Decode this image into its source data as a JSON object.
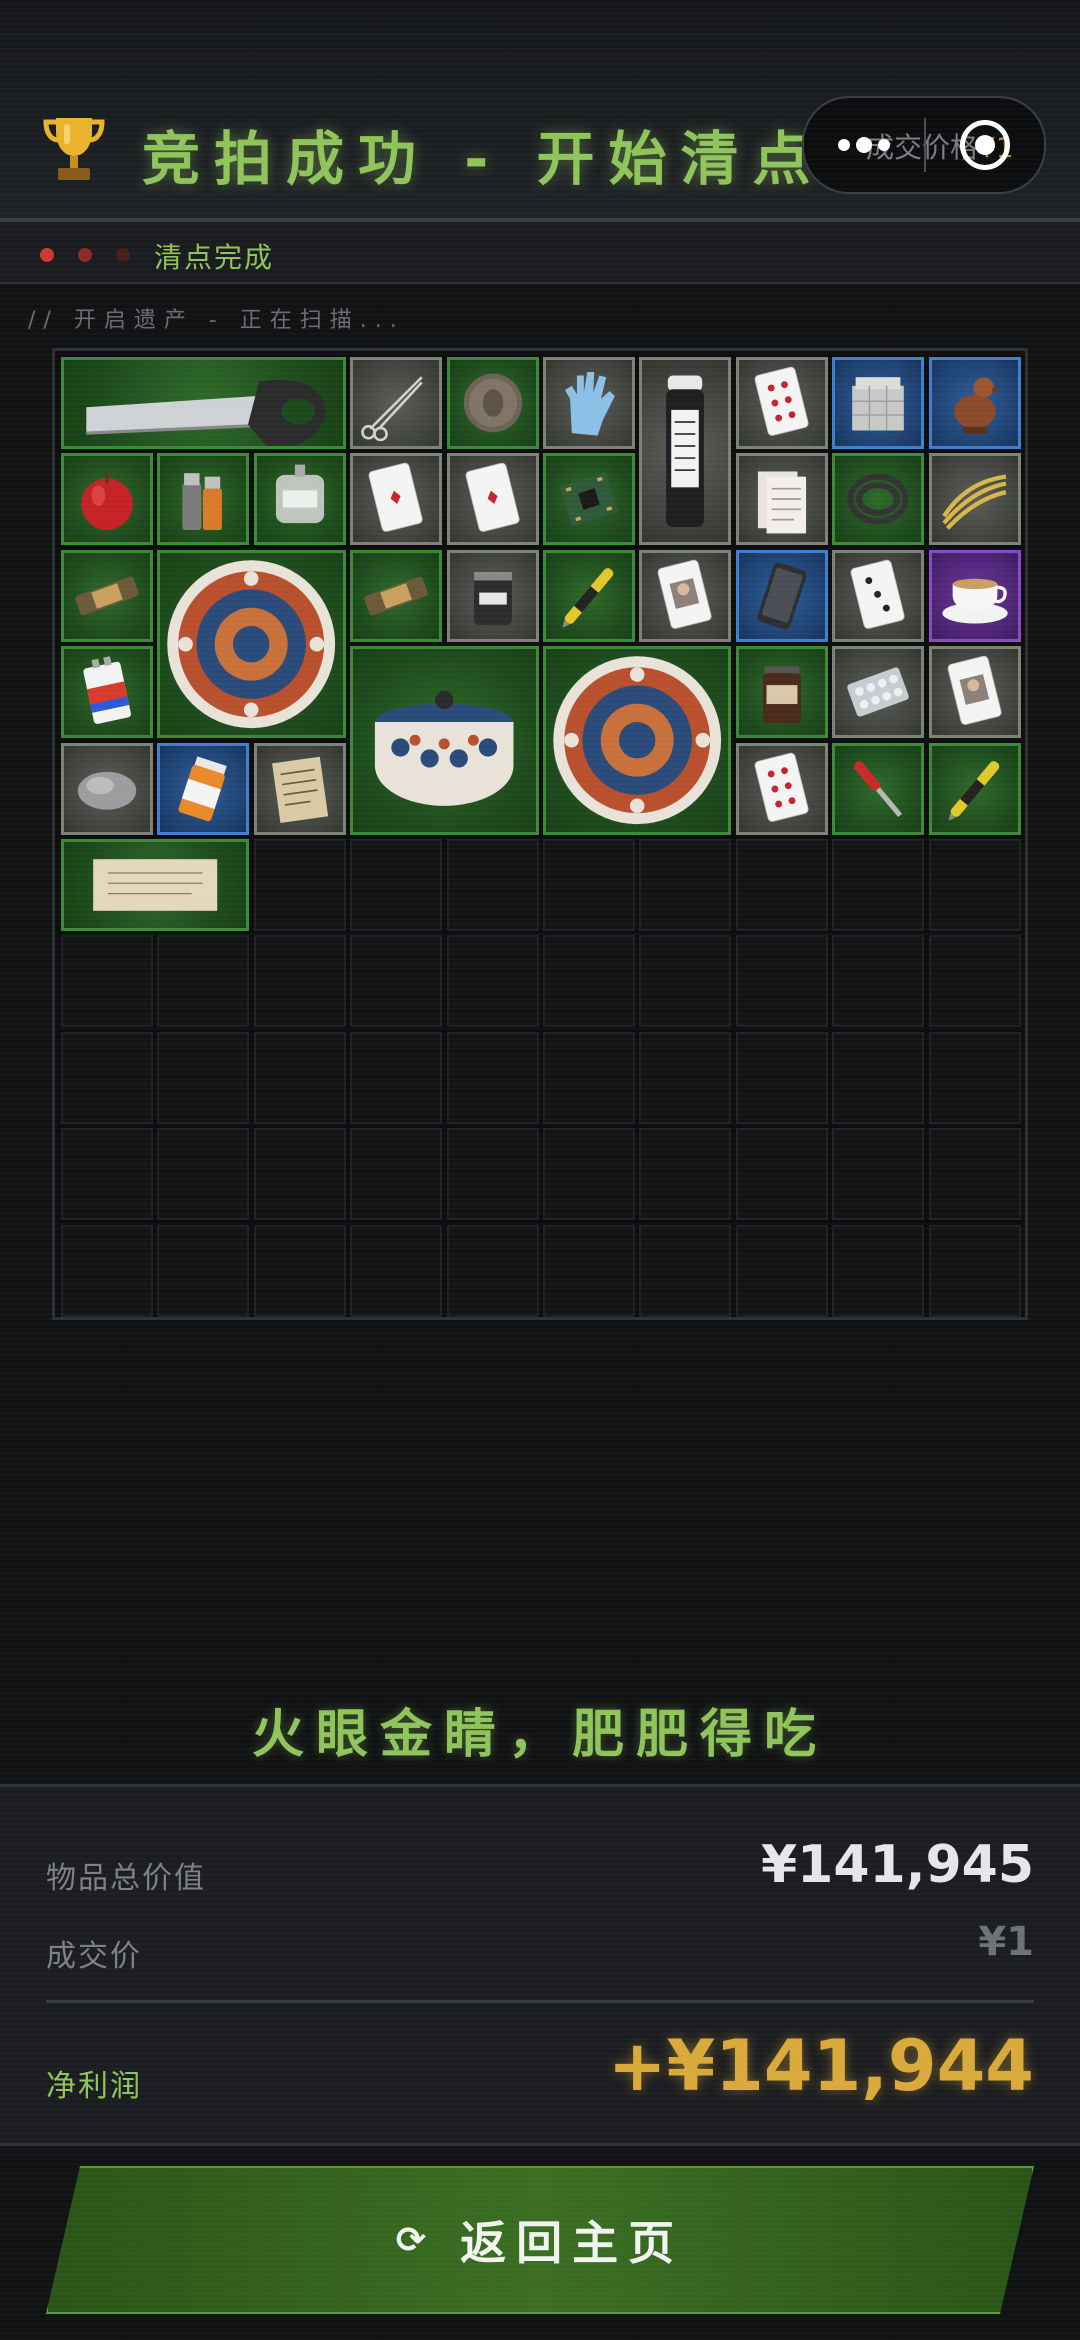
{
  "header": {
    "title": "竞拍成功 - 开始清点",
    "trophy_icon": "trophy-icon",
    "capsule_peek_label": "成交价格",
    "capsule_peek_value": "¥1"
  },
  "status_bar": {
    "text": "清点完成",
    "dot_colors": [
      "#c83a34",
      "#8a2a26",
      "#4a1c1a"
    ]
  },
  "scan_text": "// 开启遗产 - 正在扫描...",
  "inventory": {
    "columns": 10,
    "rows": 10,
    "items": [
      {
        "name": "saw",
        "rarity": "green",
        "col": 0,
        "row": 0,
        "w": 3,
        "h": 1
      },
      {
        "name": "scissors",
        "rarity": "gray",
        "col": 3,
        "row": 0,
        "w": 1,
        "h": 1
      },
      {
        "name": "coin",
        "rarity": "green",
        "col": 4,
        "row": 0,
        "w": 1,
        "h": 1
      },
      {
        "name": "glove",
        "rarity": "gray",
        "col": 5,
        "row": 0,
        "w": 1,
        "h": 1
      },
      {
        "name": "sample-bottle",
        "rarity": "gray",
        "col": 6,
        "row": 0,
        "w": 1,
        "h": 2
      },
      {
        "name": "card-hearts",
        "rarity": "gray",
        "col": 7,
        "row": 0,
        "w": 1,
        "h": 1
      },
      {
        "name": "box-stack",
        "rarity": "blue",
        "col": 8,
        "row": 0,
        "w": 1,
        "h": 1
      },
      {
        "name": "bird-figurine",
        "rarity": "blue",
        "col": 9,
        "row": 0,
        "w": 1,
        "h": 1
      },
      {
        "name": "apple",
        "rarity": "green",
        "col": 0,
        "row": 1,
        "w": 1,
        "h": 1
      },
      {
        "name": "lighter",
        "rarity": "green",
        "col": 1,
        "row": 1,
        "w": 1,
        "h": 1
      },
      {
        "name": "iv-bag",
        "rarity": "green",
        "col": 2,
        "row": 1,
        "w": 1,
        "h": 1
      },
      {
        "name": "card-diamond",
        "rarity": "gray",
        "col": 3,
        "row": 1,
        "w": 1,
        "h": 1
      },
      {
        "name": "card-diamond",
        "rarity": "gray",
        "col": 4,
        "row": 1,
        "w": 1,
        "h": 1
      },
      {
        "name": "circuit-board",
        "rarity": "green",
        "col": 5,
        "row": 1,
        "w": 1,
        "h": 1
      },
      {
        "name": "receipts",
        "rarity": "gray",
        "col": 7,
        "row": 1,
        "w": 1,
        "h": 1
      },
      {
        "name": "hose",
        "rarity": "green",
        "col": 8,
        "row": 1,
        "w": 1,
        "h": 1
      },
      {
        "name": "rope",
        "rarity": "gray",
        "col": 9,
        "row": 1,
        "w": 1,
        "h": 1
      },
      {
        "name": "snack-bar",
        "rarity": "green",
        "col": 0,
        "row": 2,
        "w": 1,
        "h": 1
      },
      {
        "name": "ornate-plate",
        "rarity": "green",
        "col": 1,
        "row": 2,
        "w": 2,
        "h": 2
      },
      {
        "name": "snack-bar",
        "rarity": "green",
        "col": 3,
        "row": 2,
        "w": 1,
        "h": 1
      },
      {
        "name": "protein-jar",
        "rarity": "gray",
        "col": 4,
        "row": 2,
        "w": 1,
        "h": 1
      },
      {
        "name": "voltage-pen",
        "rarity": "green",
        "col": 5,
        "row": 2,
        "w": 1,
        "h": 1
      },
      {
        "name": "card-portrait",
        "rarity": "gray",
        "col": 6,
        "row": 2,
        "w": 1,
        "h": 1
      },
      {
        "name": "phone",
        "rarity": "blue",
        "col": 7,
        "row": 2,
        "w": 1,
        "h": 1
      },
      {
        "name": "card-clubs",
        "rarity": "gray",
        "col": 8,
        "row": 2,
        "w": 1,
        "h": 1
      },
      {
        "name": "teacup",
        "rarity": "purple",
        "col": 9,
        "row": 2,
        "w": 1,
        "h": 1
      },
      {
        "name": "battery",
        "rarity": "green",
        "col": 0,
        "row": 3,
        "w": 1,
        "h": 1
      },
      {
        "name": "ornate-pot",
        "rarity": "green",
        "col": 3,
        "row": 3,
        "w": 2,
        "h": 2
      },
      {
        "name": "ornate-plate",
        "rarity": "green",
        "col": 5,
        "row": 3,
        "w": 2,
        "h": 2
      },
      {
        "name": "coffee-jar",
        "rarity": "green",
        "col": 7,
        "row": 3,
        "w": 1,
        "h": 1
      },
      {
        "name": "pill-blister",
        "rarity": "gray",
        "col": 8,
        "row": 3,
        "w": 1,
        "h": 1
      },
      {
        "name": "card-portrait",
        "rarity": "gray",
        "col": 9,
        "row": 3,
        "w": 1,
        "h": 1
      },
      {
        "name": "mouse",
        "rarity": "gray",
        "col": 0,
        "row": 4,
        "w": 1,
        "h": 1
      },
      {
        "name": "pill-bottle",
        "rarity": "blue",
        "col": 1,
        "row": 4,
        "w": 1,
        "h": 1
      },
      {
        "name": "old-note",
        "rarity": "gray",
        "col": 2,
        "row": 4,
        "w": 1,
        "h": 1
      },
      {
        "name": "card-hearts",
        "rarity": "gray",
        "col": 7,
        "row": 4,
        "w": 1,
        "h": 1
      },
      {
        "name": "screwdriver",
        "rarity": "green",
        "col": 8,
        "row": 4,
        "w": 1,
        "h": 1
      },
      {
        "name": "voltage-pen",
        "rarity": "green",
        "col": 9,
        "row": 4,
        "w": 1,
        "h": 1
      },
      {
        "name": "scroll-paper",
        "rarity": "green",
        "col": 0,
        "row": 5,
        "w": 2,
        "h": 1
      }
    ]
  },
  "slogan": "火眼金睛，肥肥得吃",
  "summary": {
    "total_label": "物品总价值",
    "total_value": "¥141,945",
    "deal_label": "成交价",
    "deal_value": "¥1",
    "profit_label": "净利润",
    "profit_value": "+¥141,944"
  },
  "return_button": {
    "icon": "refresh-icon",
    "label": "返回主页"
  },
  "colors": {
    "accent_green": "#8fc45a",
    "gold": "#d9a93a",
    "rarity_green": "#3c8a36",
    "rarity_gray": "#7d8277",
    "rarity_blue": "#3f7ed0",
    "rarity_purple": "#8b48c9"
  }
}
